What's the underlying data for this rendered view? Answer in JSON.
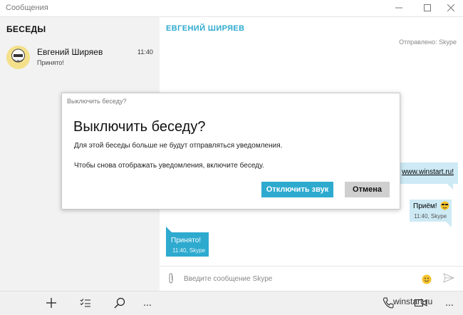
{
  "window": {
    "title": "Сообщения",
    "controls": [
      "minimize-icon",
      "maximize-icon",
      "close-icon"
    ]
  },
  "sidebar": {
    "header": "БЕСЕДЫ",
    "conversations": [
      {
        "name": "Евгений Ширяев",
        "time": "11:40",
        "preview": "Принято!"
      }
    ]
  },
  "chat": {
    "title": "ЕВГЕНИЙ ШИРЯЕВ",
    "sent_via": "Отправлено: Skype",
    "messages": [
      {
        "direction": "out",
        "text": "www.winstart.ru!"
      },
      {
        "direction": "out",
        "text": "Приём!",
        "time": "11:40, Skype"
      },
      {
        "direction": "in",
        "text": "Принято!",
        "time": "11:40, Skype"
      }
    ],
    "composer_placeholder": "Введите сообщение Skype"
  },
  "dialog": {
    "caption": "Выключить беседу?",
    "title": "Выключить беседу?",
    "line1": "Для этой беседы больше не будут отправляться уведомления.",
    "line2": "Чтобы снова отображать уведомления, включите беседу.",
    "primary_button": "Отключить звук",
    "secondary_button": "Отмена"
  },
  "bottombar": {
    "more_label": "..."
  },
  "watermark": "winstart.ru",
  "colors": {
    "accent": "#2eaacf",
    "sidebar_bg": "#f2f2f2",
    "outgoing_bubble": "#cdeaf5",
    "cancel_button": "#cfcfcf"
  }
}
